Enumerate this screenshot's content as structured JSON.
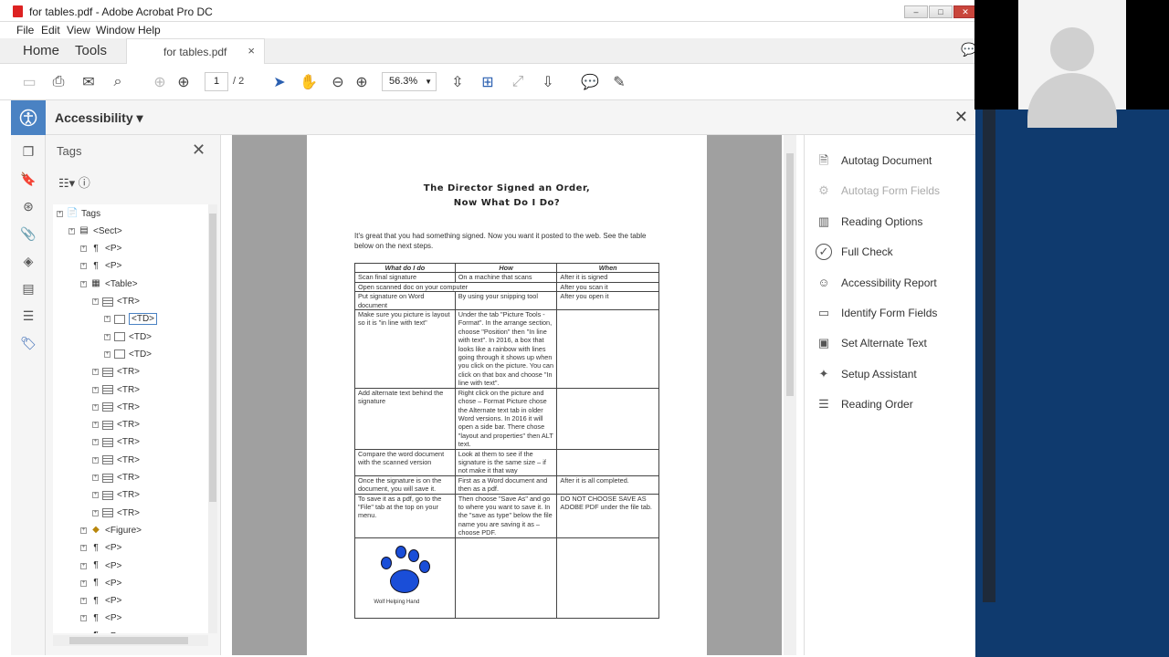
{
  "window": {
    "title": "for tables.pdf - Adobe Acrobat Pro DC"
  },
  "menu": [
    "File",
    "Edit",
    "View",
    "Window",
    "Help"
  ],
  "nav_tabs": {
    "home": "Home",
    "tools": "Tools",
    "doc_tab": "for tables.pdf"
  },
  "toolbar": {
    "page_current": "1",
    "page_total": "/ 2",
    "zoom": "56.3%"
  },
  "accessibility": {
    "title": "Accessibility ▾"
  },
  "tags_panel": {
    "title": "Tags",
    "nodes": [
      {
        "label": "Tags",
        "icon": "pdf-icon"
      },
      {
        "label": "<Sect>",
        "icon": "sect-icon"
      },
      {
        "label": "<P>",
        "icon": "paragraph-icon"
      },
      {
        "label": "<P>",
        "icon": "paragraph-icon"
      },
      {
        "label": "<Table>",
        "icon": "table-icon"
      },
      {
        "label": "<TR>",
        "icon": "row-icon"
      },
      {
        "label": "<TD>",
        "icon": "cell-icon"
      },
      {
        "label": "<TD>",
        "icon": "cell-icon"
      },
      {
        "label": "<TD>",
        "icon": "cell-icon"
      },
      {
        "label": "<TR>",
        "icon": "row-icon"
      },
      {
        "label": "<TR>",
        "icon": "row-icon"
      },
      {
        "label": "<TR>",
        "icon": "row-icon"
      },
      {
        "label": "<TR>",
        "icon": "row-icon"
      },
      {
        "label": "<TR>",
        "icon": "row-icon"
      },
      {
        "label": "<TR>",
        "icon": "row-icon"
      },
      {
        "label": "<TR>",
        "icon": "row-icon"
      },
      {
        "label": "<TR>",
        "icon": "row-icon"
      },
      {
        "label": "<TR>",
        "icon": "row-icon"
      },
      {
        "label": "<Figure>",
        "icon": "figure-icon"
      },
      {
        "label": "<P>",
        "icon": "paragraph-icon"
      },
      {
        "label": "<P>",
        "icon": "paragraph-icon"
      },
      {
        "label": "<P>",
        "icon": "paragraph-icon"
      },
      {
        "label": "<P>",
        "icon": "paragraph-icon"
      },
      {
        "label": "<P>",
        "icon": "paragraph-icon"
      },
      {
        "label": "<P>",
        "icon": "paragraph-icon"
      },
      {
        "label": "<P>",
        "icon": "paragraph-icon"
      }
    ]
  },
  "document": {
    "title_line1": "The Director Signed an Order,",
    "title_line2": "Now What Do I Do?",
    "intro": "It's great that you had something signed. Now you want it posted to the web. See the table below on the next steps.",
    "headers": [
      "What do I do",
      "How",
      "When"
    ],
    "rows": [
      [
        "Scan final signature",
        "On a machine that scans",
        "After it is signed"
      ],
      [
        "Open scanned doc on your computer",
        "",
        "After you scan it"
      ],
      [
        "Put signature on Word document",
        "By using your snipping tool",
        "After you open it"
      ],
      [
        "Make sure you picture is layout so it is \"in line with text\"",
        "Under the tab \"Picture Tools - Format\". In the arrange section, choose \"Position\" then \"In line with text\". In 2016, a box that looks like a rainbow with lines going through it shows up when you click on the picture. You can click on that box and choose \"In line with text\".",
        ""
      ],
      [
        "Add alternate text behind the signature",
        "Right click on the picture and chose – Format Picture chose the Alternate text tab in older Word versions. In 2016 it will open a side bar. There chose \"layout and properties\" then ALT text.",
        ""
      ],
      [
        "Compare the word document with the scanned version",
        "Look at them to see if the signature is the same size – if not make it that way",
        ""
      ],
      [
        "Once the signature is on the document, you will save it.",
        "First as a Word document and then as a pdf.",
        "After it is all completed."
      ],
      [
        "To save it as a pdf, go to the \"File\" tab at the top on your menu.",
        "Then choose \"Save As\" and go to where you want to save it. In the \"save as type\" below the file name you are saving it as – choose PDF.",
        "DO NOT CHOOSE SAVE AS ADOBE PDF under the file tab."
      ]
    ],
    "logo_caption": "Wolf Helping Hand"
  },
  "right_panel": {
    "items": [
      {
        "label": "Autotag Document",
        "icon": "autotag-icon",
        "enabled": true
      },
      {
        "label": "Autotag Form Fields",
        "icon": "form-autotag-icon",
        "enabled": false
      },
      {
        "label": "Reading Options",
        "icon": "reading-options-icon",
        "enabled": true
      },
      {
        "label": "Full Check",
        "icon": "check-icon",
        "enabled": true
      },
      {
        "label": "Accessibility Report",
        "icon": "accessibility-icon",
        "enabled": true
      },
      {
        "label": "Identify Form Fields",
        "icon": "form-fields-icon",
        "enabled": true
      },
      {
        "label": "Set Alternate Text",
        "icon": "image-icon",
        "enabled": true
      },
      {
        "label": "Setup Assistant",
        "icon": "wand-icon",
        "enabled": true
      },
      {
        "label": "Reading Order",
        "icon": "reading-order-icon",
        "enabled": true
      }
    ]
  }
}
